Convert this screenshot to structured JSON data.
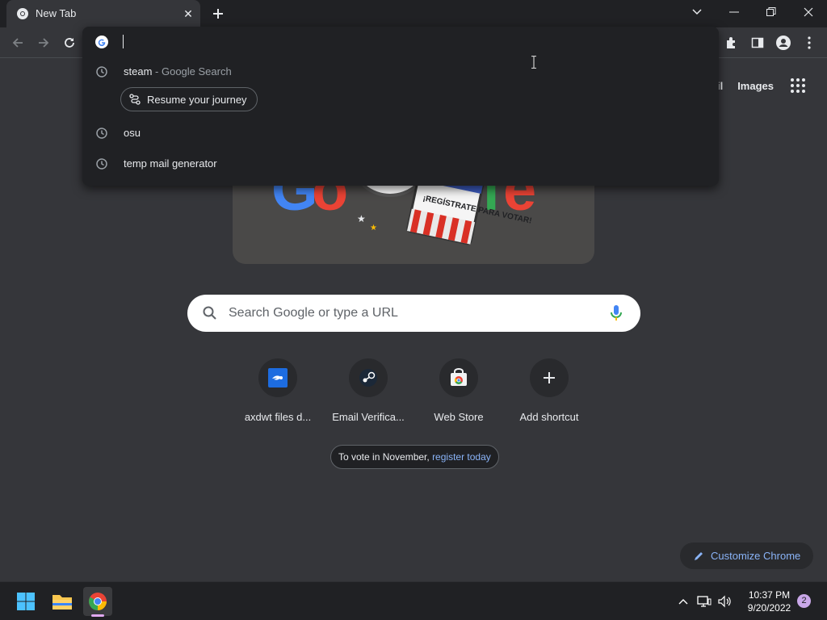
{
  "browser": {
    "tab_title": "New Tab",
    "colors": {
      "accent": "#8ab4f8",
      "background": "#35363a",
      "titlebar": "#202124"
    }
  },
  "omnibox": {
    "value": "",
    "suggestions": [
      {
        "text": "steam",
        "suffix": "- Google Search",
        "icon": "history-icon"
      },
      {
        "text": "osu",
        "suffix": "",
        "icon": "history-icon"
      },
      {
        "text": "temp mail generator",
        "suffix": "",
        "icon": "history-icon"
      }
    ],
    "journey_chip": "Resume your journey"
  },
  "ntp": {
    "top_links": {
      "gmail": "il",
      "images": "Images"
    },
    "doodle_text": "¡REGÍSTRATE PARA VOTAR!",
    "search_placeholder": "Search Google or type a URL",
    "shortcuts": [
      {
        "label": "axdwt files d...",
        "icon": "mediafire-icon"
      },
      {
        "label": "Email Verifica...",
        "icon": "steam-icon"
      },
      {
        "label": "Web Store",
        "icon": "chrome-web-store-icon"
      },
      {
        "label": "Add shortcut",
        "icon": "plus-icon"
      }
    ],
    "promo": {
      "text": "To vote in November, ",
      "link": "register today"
    },
    "customize_label": "Customize Chrome"
  },
  "taskbar": {
    "time": "10:37 PM",
    "date": "9/20/2022",
    "notification_count": "2"
  }
}
